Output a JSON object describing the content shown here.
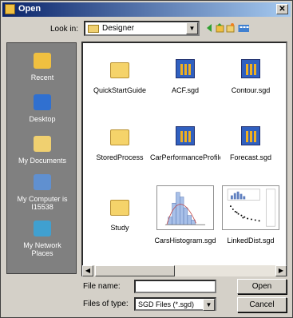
{
  "window": {
    "title": "Open",
    "close_glyph": "✕"
  },
  "lookin": {
    "label": "Look in:",
    "value": "Designer",
    "dropdown_glyph": "▼"
  },
  "toolbar": {
    "icons": [
      "back-icon",
      "up-folder-icon",
      "new-folder-icon",
      "view-menu-icon"
    ]
  },
  "places": [
    {
      "name": "recent",
      "label": "Recent",
      "icon": "recent-icon",
      "color": "#f0c040"
    },
    {
      "name": "desktop",
      "label": "Desktop",
      "icon": "desktop-icon",
      "color": "#3070d0"
    },
    {
      "name": "my-documents",
      "label": "My Documents",
      "icon": "my-documents-icon",
      "color": "#f0d070"
    },
    {
      "name": "my-computer",
      "label": "My Computer is I15538",
      "icon": "my-computer-icon",
      "color": "#6090d0"
    },
    {
      "name": "my-network",
      "label": "My Network Places",
      "icon": "network-icon",
      "color": "#40a0d0"
    }
  ],
  "files": [
    {
      "name": "QuickStartGuide",
      "kind": "folder"
    },
    {
      "name": "ACF.sgd",
      "kind": "sgd"
    },
    {
      "name": "Contour.sgd",
      "kind": "sgd"
    },
    {
      "name": "StoredProcess",
      "kind": "folder"
    },
    {
      "name": "CarPerformanceProfile",
      "kind": "sgd"
    },
    {
      "name": "Forecast.sgd",
      "kind": "sgd"
    },
    {
      "name": "Study",
      "kind": "folder"
    },
    {
      "name": "CarsHistogram.sgd",
      "kind": "thumb-histogram"
    },
    {
      "name": "LinkedDist.sgd",
      "kind": "thumb-scatter"
    }
  ],
  "scroll": {
    "left_glyph": "◀",
    "right_glyph": "▶"
  },
  "filename": {
    "label": "File name:",
    "value": ""
  },
  "filetype": {
    "label": "Files of type:",
    "value": "SGD Files (*.sgd)",
    "dropdown_glyph": "▼"
  },
  "buttons": {
    "open": "Open",
    "cancel": "Cancel"
  },
  "colors": {
    "titlebar_start": "#0a246a",
    "titlebar_end": "#a6caf0",
    "places_bg": "#808080"
  }
}
